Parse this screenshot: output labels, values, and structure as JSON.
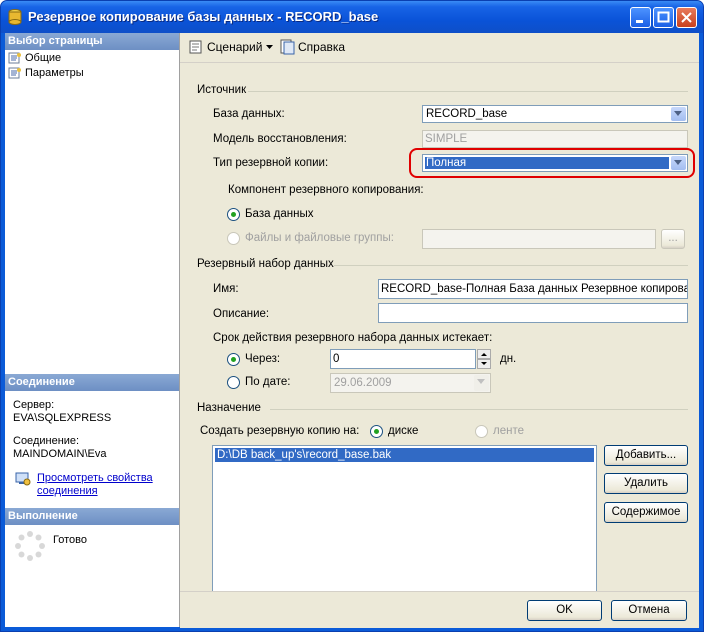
{
  "window": {
    "title": "Резервное копирование базы данных - RECORD_base"
  },
  "left": {
    "pages_header": "Выбор страницы",
    "pages": [
      {
        "label": "Общие",
        "icon": "page-icon"
      },
      {
        "label": "Параметры",
        "icon": "page-icon"
      }
    ],
    "connection_header": "Соединение",
    "server_label": "Сервер:",
    "server_value": "EVA\\SQLEXPRESS",
    "connection_label": "Соединение:",
    "connection_value": "MAINDOMAIN\\Eva",
    "view_props_line1": "Просмотреть свойства",
    "view_props_line2": "соединения",
    "progress_header": "Выполнение",
    "progress_status": "Готово"
  },
  "toolbar": {
    "script_label": "Сценарий",
    "help_label": "Справка"
  },
  "source": {
    "header": "Источник",
    "database_label": "База данных:",
    "database_value": "RECORD_base",
    "recovery_label": "Модель восстановления:",
    "recovery_value": "SIMPLE",
    "backup_type_label": "Тип резервной копии:",
    "backup_type_value": "Полная",
    "component_label": "Компонент резервного копирования:",
    "component_db": "База данных",
    "component_files": "Файлы и файловые группы:",
    "browse_label": "..."
  },
  "backup_set": {
    "header": "Резервный набор данных",
    "name_label": "Имя:",
    "name_value": "RECORD_base-Полная База данных Резервное копировани",
    "desc_label": "Описание:",
    "desc_value": "",
    "expire_label": "Срок действия резервного набора данных истекает:",
    "after_label": "Через:",
    "after_value": "0",
    "days_label": "дн.",
    "on_label": "По дате:",
    "on_value": "29.06.2009"
  },
  "destination": {
    "header": "Назначение",
    "backup_to_label": "Создать резервную копию на:",
    "disk_label": "диске",
    "tape_label": "ленте",
    "paths": [
      "D:\\DB back_up's\\record_base.bak"
    ],
    "add_label": "Добавить...",
    "remove_label": "Удалить",
    "contents_label": "Содержимое"
  },
  "footer": {
    "ok_label": "OK",
    "cancel_label": "Отмена"
  },
  "colors": {
    "titlebar": "#0a53d8",
    "highlight": "#316ac5",
    "annotation_ring": "#e00000"
  }
}
